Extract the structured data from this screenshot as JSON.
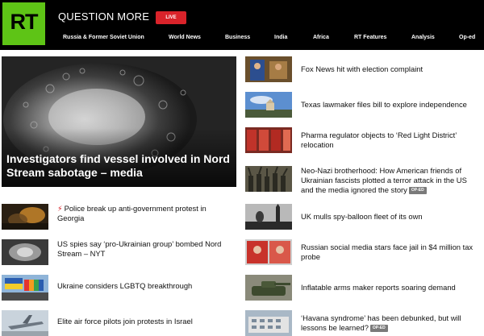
{
  "header": {
    "logo_text": "RT",
    "tagline": "QUESTION MORE",
    "live_label": "LIVE"
  },
  "nav": {
    "items": [
      "Russia & Former Soviet Union",
      "World News",
      "Business",
      "India",
      "Africa",
      "RT Features",
      "Analysis",
      "Op-ed"
    ]
  },
  "hero": {
    "title": "Investigators find vessel involved in Nord Stream sabotage – media"
  },
  "left_stories": [
    {
      "title": "Police break up anti-government protest in Georgia",
      "breaking": true
    },
    {
      "title": "US spies say ‘pro-Ukrainian group’ bombed Nord Stream – NYT"
    },
    {
      "title": "Ukraine considers LGBTQ breakthrough"
    },
    {
      "title": "Elite air force pilots join protests in Israel"
    }
  ],
  "right_stories": [
    {
      "title": "Fox News hit with election complaint"
    },
    {
      "title": "Texas lawmaker files bill to explore independence"
    },
    {
      "title": "Pharma regulator objects to ‘Red Light District’ relocation"
    },
    {
      "title": "Neo-Nazi brotherhood: How American friends of Ukrainian fascists plotted a terror attack in the US and the media ignored the story",
      "badge": "OP-ED"
    },
    {
      "title": "UK mulls spy-balloon fleet of its own"
    },
    {
      "title": "Russian social media stars face jail in $4 million tax probe"
    },
    {
      "title": "Inflatable arms maker reports soaring demand"
    },
    {
      "title": "‘Havana syndrome’ has been debunked, but will lessons be learned?",
      "badge": "OP-ED"
    }
  ],
  "colors": {
    "brand_green": "#5ec416",
    "live_red": "#d9232a",
    "header_bg": "#000000",
    "badge_gray": "#7a7a7a"
  }
}
